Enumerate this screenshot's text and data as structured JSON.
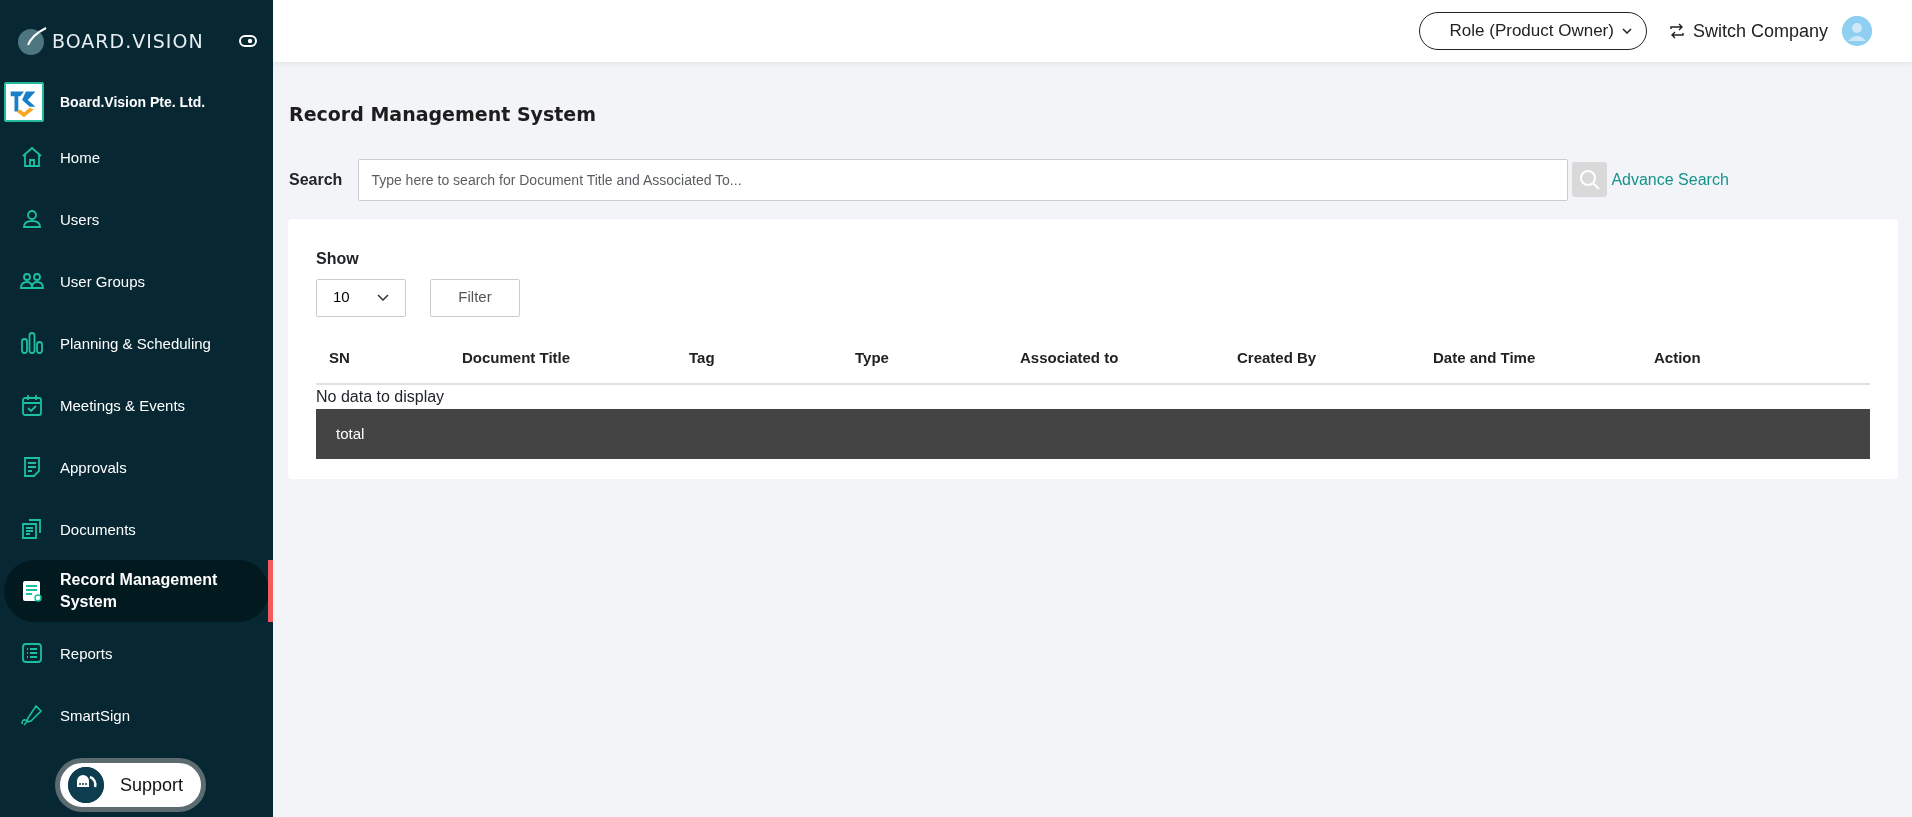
{
  "brand": {
    "name": "BOARD.VISION"
  },
  "company": {
    "name": "Board.Vision Pte. Ltd."
  },
  "sidebar": {
    "items": [
      {
        "label": "Home",
        "selected": false
      },
      {
        "label": "Users",
        "selected": false
      },
      {
        "label": "User Groups",
        "selected": false
      },
      {
        "label": "Planning & Scheduling",
        "selected": false
      },
      {
        "label": "Meetings & Events",
        "selected": false
      },
      {
        "label": "Approvals",
        "selected": false
      },
      {
        "label": "Documents",
        "selected": false
      },
      {
        "label": "Record Management System",
        "selected": true
      },
      {
        "label": "Reports",
        "selected": false
      },
      {
        "label": "SmartSign",
        "selected": false
      }
    ]
  },
  "support": {
    "label": "Support"
  },
  "header": {
    "role": "Role (Product Owner)",
    "switch_company": "Switch Company"
  },
  "page": {
    "title": "Record Management System",
    "search": {
      "label": "Search",
      "placeholder": "Type here to search for Document Title and Associated To...",
      "advance": "Advance Search"
    },
    "show": {
      "label": "Show",
      "value": "10"
    },
    "filter": "Filter",
    "table": {
      "columns": [
        "SN",
        "Document Title",
        "Tag",
        "Type",
        "Associated to",
        "Created By",
        "Date and Time",
        "Action"
      ],
      "empty": "No data to display",
      "footer": "total"
    }
  }
}
